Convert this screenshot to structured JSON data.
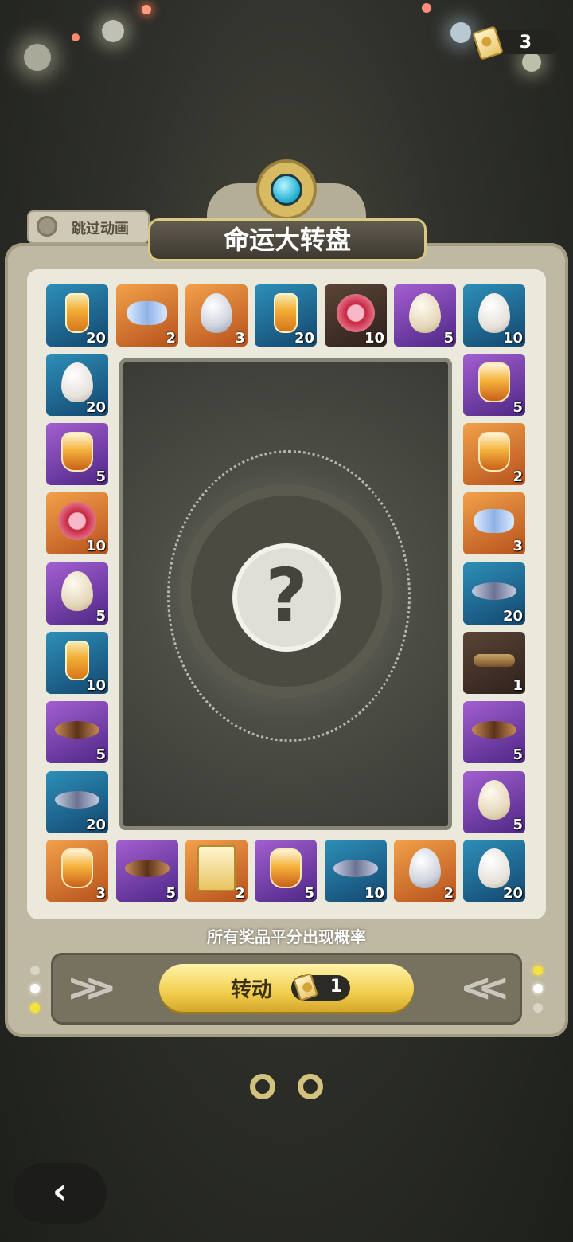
{
  "header": {
    "ticket_count": "3"
  },
  "skip_animation_label": "跳过动画",
  "title": "命运大转盘",
  "center_symbol": "?",
  "probability_note": "所有奖品平分出现概率",
  "spin": {
    "label": "转动",
    "cost": "1"
  },
  "icons": {
    "ticket": "ticket-icon",
    "back": "back-arrow-icon",
    "gear": "gear-icon"
  },
  "colors": {
    "blue": "#13466e",
    "orange": "#b6511c",
    "purple": "#4d2785",
    "dark": "#2d211c",
    "button": "#f2cf4f"
  },
  "prizes": [
    {
      "item": "potion",
      "color": "blue",
      "count": "20"
    },
    {
      "item": "bow",
      "color": "orange",
      "count": "2"
    },
    {
      "item": "egg-gray",
      "color": "orange",
      "count": "3"
    },
    {
      "item": "potion",
      "color": "blue",
      "count": "20"
    },
    {
      "item": "paw-badge",
      "color": "dark",
      "count": "10"
    },
    {
      "item": "egg",
      "color": "purple",
      "count": "5"
    },
    {
      "item": "egg-white",
      "color": "blue",
      "count": "10"
    },
    {
      "item": "bottle",
      "color": "purple",
      "count": "5"
    },
    {
      "item": "bottle",
      "color": "orange",
      "count": "2"
    },
    {
      "item": "bow",
      "color": "orange",
      "count": "3"
    },
    {
      "item": "feather",
      "color": "blue",
      "count": "20"
    },
    {
      "item": "key",
      "color": "dark",
      "count": "1"
    },
    {
      "item": "brush",
      "color": "purple",
      "count": "5"
    },
    {
      "item": "egg",
      "color": "purple",
      "count": "5"
    },
    {
      "item": "egg-white",
      "color": "blue",
      "count": "20"
    },
    {
      "item": "egg-gray",
      "color": "orange",
      "count": "2"
    },
    {
      "item": "feather",
      "color": "blue",
      "count": "10"
    },
    {
      "item": "bottle",
      "color": "purple",
      "count": "5"
    },
    {
      "item": "ticket",
      "color": "orange",
      "count": "2"
    },
    {
      "item": "brush",
      "color": "purple",
      "count": "5"
    },
    {
      "item": "bottle",
      "color": "orange",
      "count": "3"
    },
    {
      "item": "feather",
      "color": "blue",
      "count": "20"
    },
    {
      "item": "brush",
      "color": "purple",
      "count": "5"
    },
    {
      "item": "potion",
      "color": "blue",
      "count": "10"
    },
    {
      "item": "egg",
      "color": "purple",
      "count": "5"
    },
    {
      "item": "paw-badge",
      "color": "orange",
      "count": "10"
    },
    {
      "item": "bottle",
      "color": "purple",
      "count": "5"
    },
    {
      "item": "egg-white",
      "color": "blue",
      "count": "20"
    }
  ]
}
